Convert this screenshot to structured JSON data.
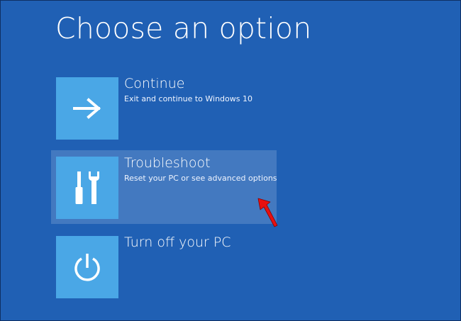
{
  "page": {
    "title": "Choose an option"
  },
  "options": [
    {
      "title": "Continue",
      "description": "Exit and continue to Windows 10",
      "icon": "arrow-right-icon"
    },
    {
      "title": "Troubleshoot",
      "description": "Reset your PC or see advanced options",
      "icon": "tools-icon",
      "hovered": true
    },
    {
      "title": "Turn off your PC",
      "description": "",
      "icon": "power-icon"
    }
  ],
  "colors": {
    "background": "#2060b4",
    "tile": "#4aa7e6",
    "hover": "rgba(255,255,255,0.16)",
    "pointer": "#e81010"
  }
}
